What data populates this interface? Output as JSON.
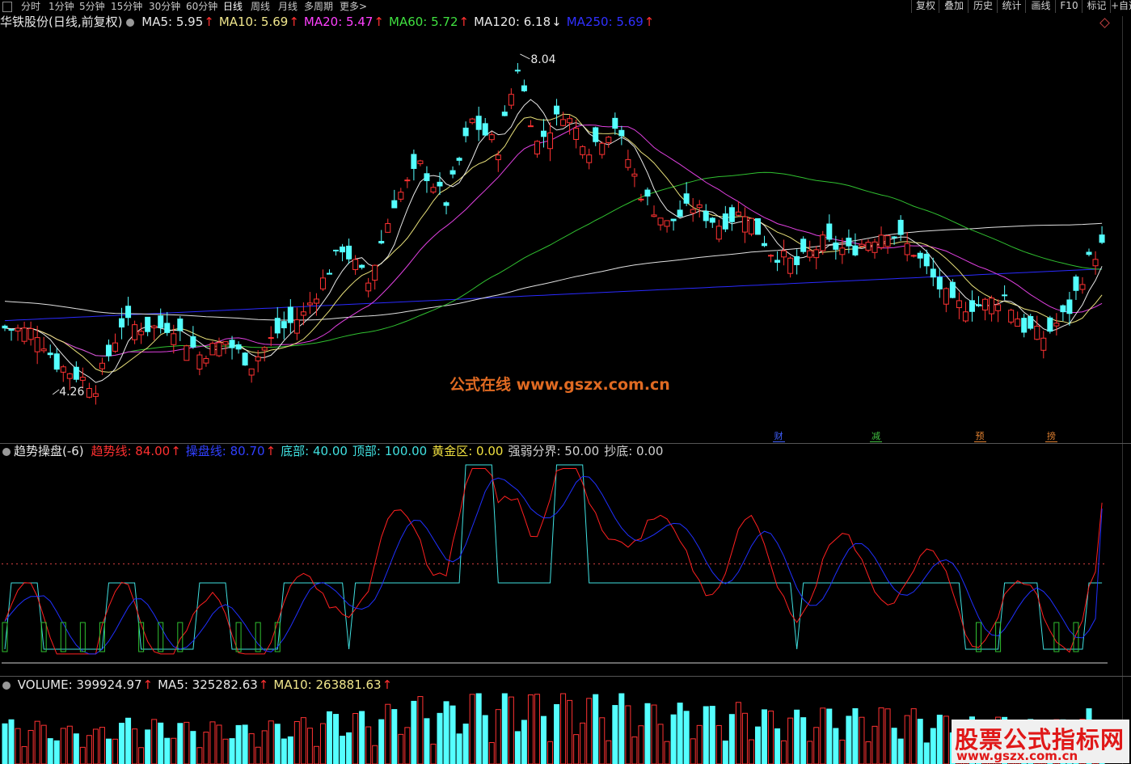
{
  "toolbar": {
    "periods": [
      "分时",
      "1分钟",
      "5分钟",
      "15分钟",
      "30分钟",
      "60分钟",
      "日线",
      "周线",
      "月线",
      "多周期",
      "更多>"
    ],
    "active_period": "日线",
    "right_buttons": [
      "复权",
      "叠加",
      "历史",
      "统计",
      "画线",
      "F10",
      "标记",
      "+自选"
    ]
  },
  "main_legend": {
    "title": "华铁股份(日线,前复权)",
    "items": [
      {
        "label": "MA5: 5.95",
        "color": "#e8e8e8",
        "up": true
      },
      {
        "label": "MA10: 5.69",
        "color": "#f0e68c",
        "up": true
      },
      {
        "label": "MA20: 5.47",
        "color": "#ff40ff",
        "up": true
      },
      {
        "label": "MA60: 5.72",
        "color": "#40e040",
        "up": true
      },
      {
        "label": "MA120: 6.18",
        "color": "#e8e8e8",
        "up": false
      },
      {
        "label": "MA250: 5.69",
        "color": "#3030ff",
        "up": true
      }
    ]
  },
  "indicator_legend": {
    "title": "趋势操盘(-6)",
    "items": [
      {
        "label": "趋势线: 84.00",
        "color": "#ff3030",
        "up": true
      },
      {
        "label": "操盘线: 80.70",
        "color": "#3040ff",
        "up": true
      },
      {
        "label": "底部: 40.00",
        "color": "#40e0e0",
        "up": null
      },
      {
        "label": "顶部: 100.00",
        "color": "#40e0e0",
        "up": null
      },
      {
        "label": "黄金区: 0.00",
        "color": "#f0e040",
        "up": null
      },
      {
        "label": "强弱分界: 50.00",
        "color": "#d0d0d0",
        "up": null
      },
      {
        "label": "抄底: 0.00",
        "color": "#d0d0d0",
        "up": null
      }
    ]
  },
  "volume_legend": {
    "items": [
      {
        "label": "VOLUME: 399924.97",
        "color": "#e8e8e8",
        "up": true
      },
      {
        "label": "MA5: 325282.63",
        "color": "#e8e8e8",
        "up": true
      },
      {
        "label": "MA10: 263881.63",
        "color": "#f0e68c",
        "up": true
      }
    ]
  },
  "price_labels": {
    "high": "8.04",
    "low": "4.26"
  },
  "events": [
    {
      "label": "财",
      "color": "#4060ff",
      "index": 119
    },
    {
      "label": "减",
      "color": "#40c040",
      "index": 134
    },
    {
      "label": "预",
      "color": "#e08030",
      "index": 150
    },
    {
      "label": "搒",
      "color": "#e08030",
      "index": 161
    }
  ],
  "watermark": {
    "center": "公式在线  www.gszx.com.cn",
    "badge_title": "股票公式指标网",
    "badge_url": "www.gszx.com.cn"
  },
  "colors": {
    "up": "#ff3232",
    "down": "#54ffff",
    "background": "#000000"
  },
  "chart_data": [
    {
      "type": "candlestick",
      "series_name": "华铁股份",
      "ylim": [
        3.9,
        8.3
      ],
      "high": 8.04,
      "low": 4.26,
      "moving_averages": [
        "MA5",
        "MA10",
        "MA20",
        "MA60",
        "MA120",
        "MA250"
      ]
    },
    {
      "type": "line",
      "series": [
        {
          "name": "趋势线",
          "last": 84.0
        },
        {
          "name": "操盘线",
          "last": 80.7
        }
      ],
      "levels": {
        "底部": 40.0,
        "顶部": 100.0,
        "强弱分界": 50.0
      },
      "ylim": [
        -5,
        105
      ]
    },
    {
      "type": "bar",
      "series_name": "VOLUME",
      "last": 399924.97,
      "ma5": 325282.63,
      "ma10": 263881.63
    }
  ]
}
